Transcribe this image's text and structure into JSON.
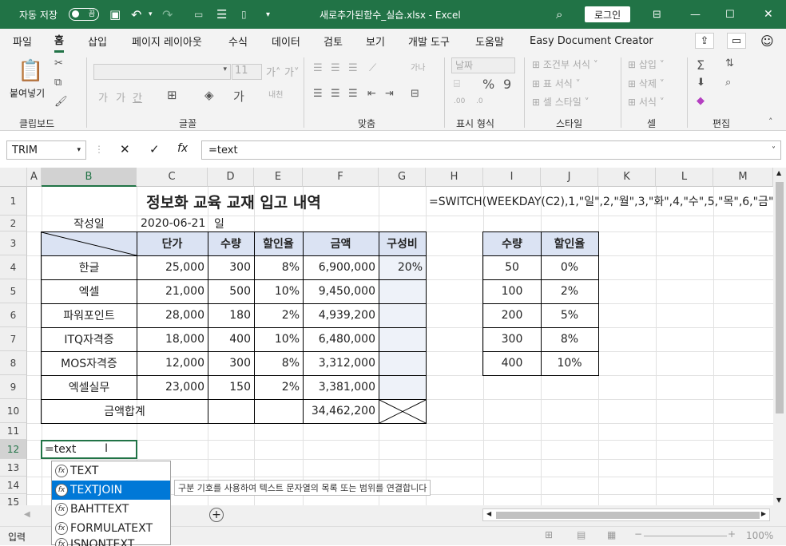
{
  "titlebar": {
    "autosave": "자동 저장",
    "toggle": "끔",
    "filename": "새로추가된함수_실습.xlsx - Excel",
    "login": "로그인"
  },
  "menu": [
    "파일",
    "홈",
    "삽입",
    "페이지 레이아웃",
    "수식",
    "데이터",
    "검토",
    "보기",
    "개발 도구",
    "도움말",
    "Easy Document Creator"
  ],
  "ribbon": {
    "paste": "붙여넣기",
    "font_name": "",
    "font_size": "11",
    "number_format": "날짜",
    "cond_format": "조건부 서식",
    "table_format": "표 서식",
    "cell_style": "셀 스타일",
    "insert": "삽입",
    "delete": "삭제",
    "format": "서식",
    "groups": [
      "클립보드",
      "글꼴",
      "맞춤",
      "표시 형식",
      "스타일",
      "셀",
      "편집"
    ]
  },
  "namebox": "TRIM",
  "formula": "=text",
  "columns": [
    "A",
    "B",
    "C",
    "D",
    "E",
    "F",
    "G",
    "H",
    "I",
    "J",
    "K",
    "L",
    "M"
  ],
  "rows": [
    "1",
    "2",
    "3",
    "4",
    "5",
    "6",
    "7",
    "8",
    "9",
    "10",
    "11",
    "12",
    "13",
    "14",
    "15"
  ],
  "sheet": {
    "title": "정보화 교육 교재 입고 내역",
    "switch_formula": "=SWITCH(WEEKDAY(C2),1,\"일\",2,\"월\",3,\"화\",4,\"수\",5,\"목\",6,\"금\",7,",
    "author_label": "작성일",
    "date": "2020-06-21",
    "day": "일",
    "headers": [
      "단가",
      "수량",
      "할인율",
      "금액",
      "구성비"
    ],
    "items": [
      {
        "name": "한글",
        "price": "25,000",
        "qty": "300",
        "rate": "8%",
        "amount": "6,900,000",
        "ratio": "20%"
      },
      {
        "name": "엑셀",
        "price": "21,000",
        "qty": "500",
        "rate": "10%",
        "amount": "9,450,000",
        "ratio": ""
      },
      {
        "name": "파워포인트",
        "price": "28,000",
        "qty": "180",
        "rate": "2%",
        "amount": "4,939,200",
        "ratio": ""
      },
      {
        "name": "ITQ자격증",
        "price": "18,000",
        "qty": "400",
        "rate": "10%",
        "amount": "6,480,000",
        "ratio": ""
      },
      {
        "name": "MOS자격증",
        "price": "12,000",
        "qty": "300",
        "rate": "8%",
        "amount": "3,312,000",
        "ratio": ""
      },
      {
        "name": "엑셀실무",
        "price": "23,000",
        "qty": "150",
        "rate": "2%",
        "amount": "3,381,000",
        "ratio": ""
      }
    ],
    "total_label": "금액합계",
    "total": "34,462,200",
    "lookup_headers": [
      "수량",
      "할인율"
    ],
    "lookup": [
      [
        "50",
        "0%"
      ],
      [
        "100",
        "2%"
      ],
      [
        "200",
        "5%"
      ],
      [
        "300",
        "8%"
      ],
      [
        "400",
        "10%"
      ]
    ],
    "editing": "=text"
  },
  "autocomplete": [
    "TEXT",
    "TEXTJOIN",
    "BAHTTEXT",
    "FORMULATEXT",
    "ISNONTEXT"
  ],
  "tooltip": "구분 기호를 사용하여 텍스트 문자열의 목록 또는 범위를 연결합니다",
  "status": {
    "mode": "입력",
    "zoom": "100%"
  }
}
